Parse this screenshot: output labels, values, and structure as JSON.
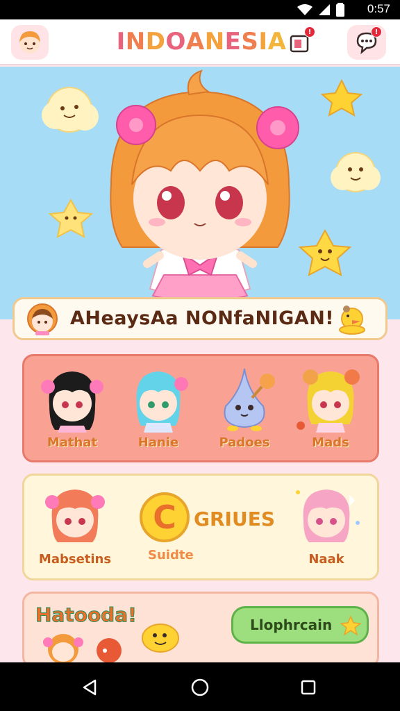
{
  "status_bar": {
    "time": "0:57",
    "icons": [
      "wifi-icon",
      "signal-icon",
      "battery-icon"
    ]
  },
  "header": {
    "title": "INDOANESIA",
    "title_colors": [
      "#e8637c",
      "#ef7f4e",
      "#f3a23d",
      "#e8637c",
      "#ef7f4e",
      "#f3a23d",
      "#e8637c",
      "#ef7f4e",
      "#f3a23d",
      "#f3b63d"
    ],
    "notifications_badge": "!",
    "messages_badge": "!"
  },
  "welcome": {
    "text": "AHeaysAa NONfaNIGAN!"
  },
  "characters_row": [
    {
      "label": "Mathat",
      "hair": "#1c1c1c",
      "accent": "#ff7ab9"
    },
    {
      "label": "Hanie",
      "hair": "#62d3e8",
      "accent": "#ff77b5"
    },
    {
      "label": "Padoes",
      "hair": "#b6c6f2",
      "accent": "#f6a24b"
    },
    {
      "label": "Mads",
      "hair": "#f5d233",
      "accent": "#f27a48"
    }
  ],
  "featured_row": [
    {
      "label": "Mabsetins",
      "hair": "#f27b59",
      "accent": "#ff7ab9"
    },
    {
      "label": "Suidte",
      "hair": "#f3c43a",
      "accent": "#f2a34a"
    },
    {
      "label": "Naak",
      "hair": "#f7a5c4",
      "accent": "#ffffff"
    }
  ],
  "featured_promo": "GRIUES",
  "featured_logo_letter": "C",
  "bottom_panel": {
    "banner": "Hatooda!",
    "cta_label": "Llophrcain"
  },
  "colors": {
    "hero_bg": "#a6dcf6",
    "accent_pink": "#ff7ab9",
    "accent_orange": "#f3a23d"
  }
}
